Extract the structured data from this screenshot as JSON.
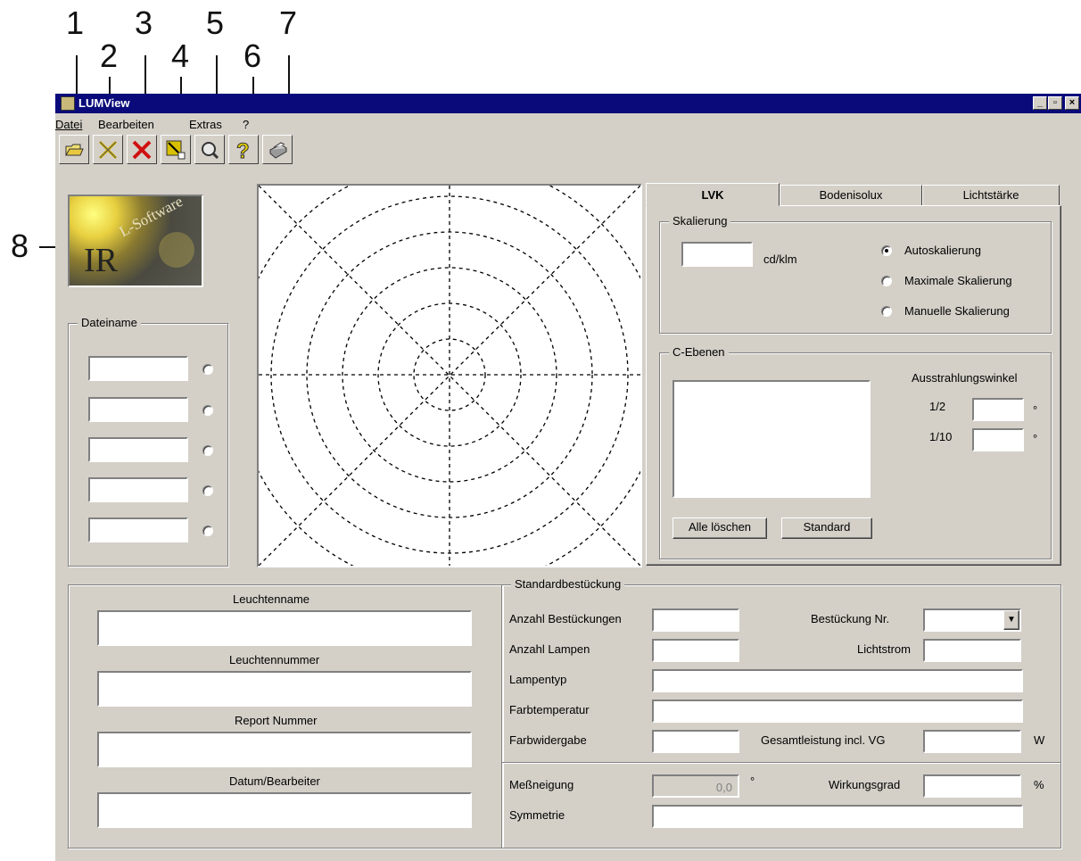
{
  "callouts": [
    "1",
    "2",
    "3",
    "4",
    "5",
    "6",
    "7",
    "8"
  ],
  "window": {
    "title": "LUMView",
    "controls": {
      "minimize": "_",
      "maximize": "▫",
      "close": "×"
    }
  },
  "menu": [
    {
      "label": "Datei"
    },
    {
      "label": "Bearbeiten"
    },
    {
      "label": "Extras"
    },
    {
      "label": "?"
    }
  ],
  "toolbar": [
    {
      "name": "open-folder-icon"
    },
    {
      "name": "scissors-icon"
    },
    {
      "name": "delete-x-icon"
    },
    {
      "name": "arrow-chart-icon"
    },
    {
      "name": "magnifier-icon"
    },
    {
      "name": "help-icon"
    },
    {
      "name": "printer-icon"
    }
  ],
  "logo": {
    "text_ir": "IR",
    "text_sub": "L-Software"
  },
  "dateiname": {
    "legend": "Dateiname",
    "fields": [
      "",
      "",
      "",
      "",
      ""
    ]
  },
  "tabs": [
    "LVK",
    "Bodenisolux",
    "Lichtstärke"
  ],
  "skalierung": {
    "legend": "Skalierung",
    "value": "",
    "unit": "cd/klm",
    "options": [
      "Autoskalierung",
      "Maximale Skalierung",
      "Manuelle Skalierung"
    ],
    "selected": "Autoskalierung"
  },
  "c_ebenen": {
    "legend": "C-Ebenen",
    "ausstrahlung_label": "Ausstrahlungswinkel",
    "half_label": "1/2",
    "tenth_label": "1/10",
    "half_value": "",
    "tenth_value": "",
    "degree": "°",
    "clear_button": "Alle löschen",
    "standard_button": "Standard"
  },
  "leuchte": {
    "name_label": "Leuchtenname",
    "number_label": "Leuchtennummer",
    "report_label": "Report Nummer",
    "date_label": "Datum/Bearbeiter",
    "name_value": "",
    "number_value": "",
    "report_value": "",
    "date_value": ""
  },
  "standard": {
    "legend": "Standardbestückung",
    "anzahl_bestueckungen": "Anzahl Bestückungen",
    "bestueckung_nr": "Bestückung Nr.",
    "anzahl_lampen": "Anzahl Lampen",
    "lichtstrom": "Lichtstrom",
    "lampentyp": "Lampentyp",
    "farbtemperatur": "Farbtemperatur",
    "farbwidergabe": "Farbwidergabe",
    "gesamtleistung": "Gesamtleistung incl. VG",
    "unit_w": "W",
    "messneigung": "Meßneigung",
    "messneigung_value": "0,0",
    "degree": "°",
    "wirkungsgrad": "Wirkungsgrad",
    "unit_percent": "%",
    "symmetrie": "Symmetrie"
  }
}
